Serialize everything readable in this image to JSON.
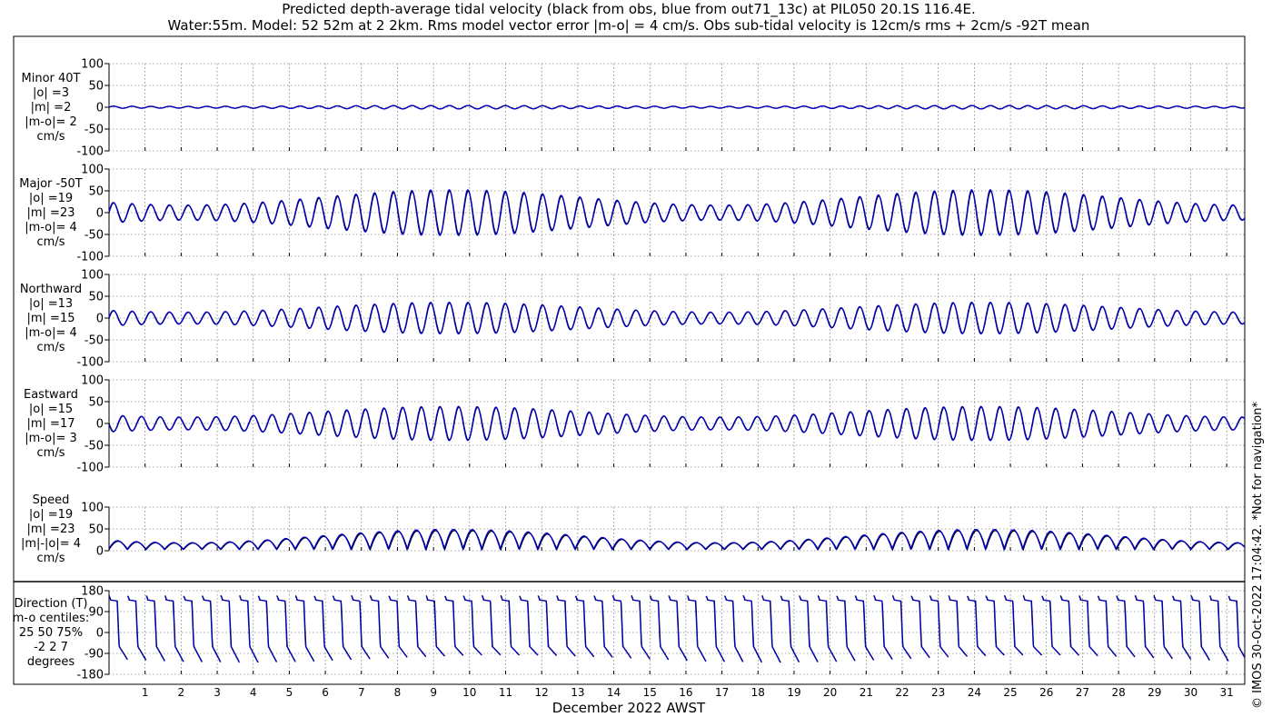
{
  "title_line1": "Predicted depth-average tidal velocity (black from obs, blue from out71_13c) at PIL050 20.1S 116.4E.",
  "title_line2": "Water:55m. Model: 52 52m at 2 2km. Rms model vector error |m-o| = 4 cm/s. Obs sub-tidal velocity is 12cm/s rms + 2cm/s -92T mean",
  "xlabel": "December 2022 AWST",
  "copyright": "© IMOS 30-Oct-2022 17:04:42. *Not for navigation*",
  "colors": {
    "obs": "#000000",
    "model": "#0000cc",
    "grid": "#555555",
    "axis": "#000000"
  },
  "chart_data": [
    {
      "type": "line",
      "label_lines": [
        "Minor 40T",
        "|o| =3",
        "|m| =2",
        "|m-o|= 2",
        "cm/s"
      ],
      "ylim": [
        -100,
        100
      ],
      "yticks": [
        100,
        50,
        0,
        -50,
        -100
      ],
      "xlim": [
        0,
        31.5
      ],
      "xticks": [
        1,
        2,
        3,
        4,
        5,
        6,
        7,
        8,
        9,
        10,
        11,
        12,
        13,
        14,
        15,
        16,
        17,
        18,
        19,
        20,
        21,
        22,
        23,
        24,
        25,
        26,
        27,
        28,
        29,
        30,
        31
      ],
      "grid": true,
      "series": [
        {
          "color": "obs",
          "amplitude": 3,
          "mean": 0,
          "springneap_mod": 0.3,
          "phase_deg": 0,
          "kind": "sinusoid"
        },
        {
          "color": "model",
          "amplitude": 3,
          "mean": 0,
          "springneap_mod": 0.3,
          "phase_deg": 5,
          "kind": "sinusoid"
        }
      ]
    },
    {
      "type": "line",
      "label_lines": [
        "Major -50T",
        "|o| =19",
        "|m| =23",
        "|m-o|= 4",
        "cm/s"
      ],
      "ylim": [
        -100,
        100
      ],
      "yticks": [
        100,
        50,
        0,
        -50,
        -100
      ],
      "xlim": [
        0,
        31.5
      ],
      "xticks": [
        1,
        2,
        3,
        4,
        5,
        6,
        7,
        8,
        9,
        10,
        11,
        12,
        13,
        14,
        15,
        16,
        17,
        18,
        19,
        20,
        21,
        22,
        23,
        24,
        25,
        26,
        27,
        28,
        29,
        30,
        31
      ],
      "grid": true,
      "series": [
        {
          "color": "obs",
          "amplitude": 33,
          "mean": 0,
          "springneap_mod": 0.5,
          "phase_deg": 0,
          "kind": "sinusoid"
        },
        {
          "color": "model",
          "amplitude": 35,
          "mean": 0,
          "springneap_mod": 0.5,
          "phase_deg": 6,
          "kind": "sinusoid"
        }
      ]
    },
    {
      "type": "line",
      "label_lines": [
        "Northward",
        "|o| =13",
        "|m| =15",
        "|m-o|= 4",
        "cm/s"
      ],
      "ylim": [
        -100,
        100
      ],
      "yticks": [
        100,
        50,
        0,
        -50,
        -100
      ],
      "xlim": [
        0,
        31.5
      ],
      "xticks": [
        1,
        2,
        3,
        4,
        5,
        6,
        7,
        8,
        9,
        10,
        11,
        12,
        13,
        14,
        15,
        16,
        17,
        18,
        19,
        20,
        21,
        22,
        23,
        24,
        25,
        26,
        27,
        28,
        29,
        30,
        31
      ],
      "grid": true,
      "series": [
        {
          "color": "obs",
          "amplitude": 24,
          "mean": 0,
          "springneap_mod": 0.45,
          "phase_deg": 0,
          "kind": "sinusoid"
        },
        {
          "color": "model",
          "amplitude": 25,
          "mean": 0,
          "springneap_mod": 0.45,
          "phase_deg": 6,
          "kind": "sinusoid"
        }
      ]
    },
    {
      "type": "line",
      "label_lines": [
        "Eastward",
        "|o| =15",
        "|m| =17",
        "|m-o|= 3",
        "cm/s"
      ],
      "ylim": [
        -100,
        100
      ],
      "yticks": [
        100,
        50,
        0,
        -50,
        -100
      ],
      "xlim": [
        0,
        31.5
      ],
      "xticks": [
        1,
        2,
        3,
        4,
        5,
        6,
        7,
        8,
        9,
        10,
        11,
        12,
        13,
        14,
        15,
        16,
        17,
        18,
        19,
        20,
        21,
        22,
        23,
        24,
        25,
        26,
        27,
        28,
        29,
        30,
        31
      ],
      "grid": true,
      "series": [
        {
          "color": "obs",
          "amplitude": 26,
          "mean": 0,
          "springneap_mod": 0.45,
          "phase_deg": 180,
          "kind": "sinusoid"
        },
        {
          "color": "model",
          "amplitude": 27,
          "mean": 0,
          "springneap_mod": 0.45,
          "phase_deg": 186,
          "kind": "sinusoid"
        }
      ]
    },
    {
      "type": "line",
      "label_lines": [
        "Speed",
        "|o| =19",
        "|m| =23",
        "|m|-|o|= 4",
        "cm/s"
      ],
      "ylim": [
        0,
        100
      ],
      "yticks": [
        100,
        50,
        0
      ],
      "xlim": [
        0,
        31.5
      ],
      "xticks": [
        1,
        2,
        3,
        4,
        5,
        6,
        7,
        8,
        9,
        10,
        11,
        12,
        13,
        14,
        15,
        16,
        17,
        18,
        19,
        20,
        21,
        22,
        23,
        24,
        25,
        26,
        27,
        28,
        29,
        30,
        31
      ],
      "grid": true,
      "series": [
        {
          "color": "obs",
          "amplitude": 32,
          "mean": 0,
          "springneap_mod": 0.5,
          "phase_deg": 0,
          "kind": "speed"
        },
        {
          "color": "model",
          "amplitude": 34,
          "mean": 0,
          "springneap_mod": 0.5,
          "phase_deg": 6,
          "kind": "speed"
        }
      ]
    },
    {
      "type": "line",
      "label_lines": [
        "Direction (T)",
        "m-o centiles:",
        "25  50  75%",
        "-2  2  7",
        "degrees"
      ],
      "ylim": [
        -180,
        180
      ],
      "yticks": [
        180,
        90,
        0,
        -90,
        -180
      ],
      "xlim": [
        0,
        31.5
      ],
      "xticks": [
        1,
        2,
        3,
        4,
        5,
        6,
        7,
        8,
        9,
        10,
        11,
        12,
        13,
        14,
        15,
        16,
        17,
        18,
        19,
        20,
        21,
        22,
        23,
        24,
        25,
        26,
        27,
        28,
        29,
        30,
        31
      ],
      "grid": true,
      "series": [
        {
          "color": "obs",
          "kind": "direction",
          "phase_deg": 0
        },
        {
          "color": "model",
          "kind": "direction",
          "phase_deg": 6
        }
      ]
    }
  ]
}
